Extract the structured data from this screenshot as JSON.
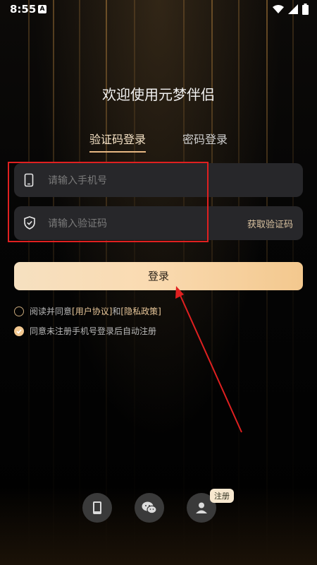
{
  "status_bar": {
    "time": "8:55",
    "notification_icon": "A"
  },
  "header": {
    "welcome": "欢迎使用元梦伴侣"
  },
  "tabs": [
    {
      "label": "验证码登录",
      "active": true
    },
    {
      "label": "密码登录",
      "active": false
    }
  ],
  "form": {
    "phone_placeholder": "请输入手机号",
    "phone_value": "",
    "code_placeholder": "请输入验证码",
    "code_value": "",
    "get_code_label": "获取验证码",
    "login_label": "登录"
  },
  "agreements": {
    "line1_prefix": "阅读并同意",
    "user_agreement": "[用户协议]",
    "and": "和",
    "privacy_policy": "[隐私政策]",
    "line1_checked": false,
    "line2": "同意未注册手机号登录后自动注册",
    "line2_checked": true
  },
  "bottom": {
    "register_tag": "注册",
    "icons": [
      "phone-icon",
      "wechat-icon",
      "user-icon"
    ]
  },
  "colors": {
    "accent": "#e7b883",
    "button_gradient_start": "#f6e0c0",
    "button_gradient_end": "#f3c88e",
    "field_bg": "#27272a",
    "annotation_red": "#e02020"
  }
}
